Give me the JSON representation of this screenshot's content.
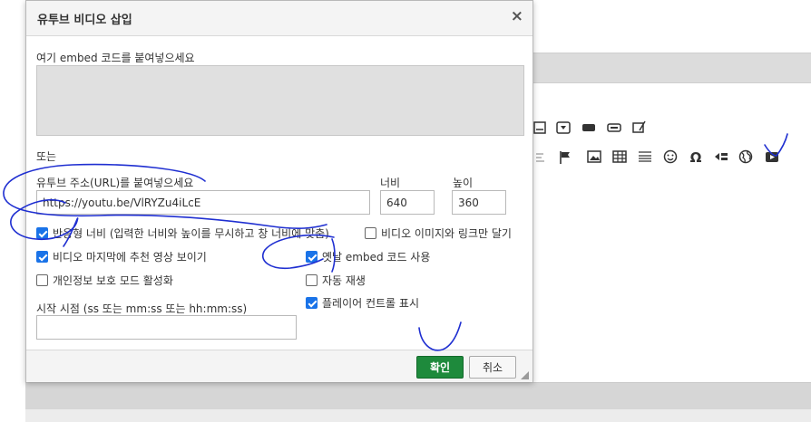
{
  "dialog": {
    "title": "유투브 비디오 삽입",
    "close": "×",
    "embed_label": "여기 embed 코드를 붙여넣으세요",
    "or_label": "또는",
    "url_label": "유투브 주소(URL)를 붙여넣으세요",
    "url_value": "https://youtu.be/VlRYZu4iLcE",
    "width_label": "너비",
    "width_value": "640",
    "height_label": "높이",
    "height_value": "360",
    "options_left": [
      {
        "label": "반응형 너비 (입력한 너비와 높이를 무시하고 창 너비에 맞춤)",
        "checked": true
      },
      {
        "label": "비디오 마지막에 추천 영상 보이기",
        "checked": true
      },
      {
        "label": "개인정보 보호 모드 활성화",
        "checked": false
      }
    ],
    "option_image_link": {
      "label": "비디오 이미지와 링크만 달기",
      "checked": false
    },
    "options_right": [
      {
        "label": "옛날 embed 코드 사용",
        "checked": true
      },
      {
        "label": "자동 재생",
        "checked": false
      },
      {
        "label": "플레이어 컨트롤 표시",
        "checked": true
      }
    ],
    "start_label": "시작 시점 (ss 또는 mm:ss 또는 hh:mm:ss)",
    "start_value": "",
    "ok_label": "확인",
    "cancel_label": "취소"
  },
  "toolbar": {
    "omega_symbol": "Ω"
  },
  "colors": {
    "ok_button": "#1e8a3c",
    "checkbox_checked": "#1a73e8",
    "annotation_ink": "#1f2fd1"
  }
}
